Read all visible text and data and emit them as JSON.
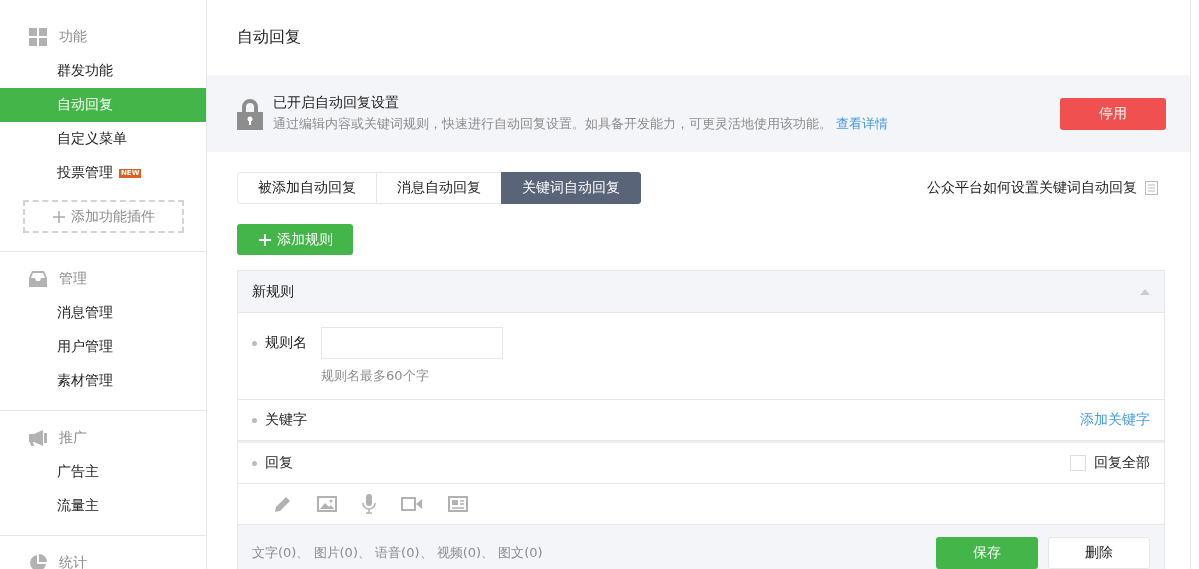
{
  "sidebar": {
    "sections": [
      {
        "title": "功能",
        "kind": "grid",
        "items": [
          {
            "label": "群发功能",
            "selected": false
          },
          {
            "label": "自动回复",
            "selected": true
          },
          {
            "label": "自定义菜单",
            "selected": false
          },
          {
            "label": "投票管理",
            "selected": false,
            "badge": "NEW"
          }
        ],
        "add_button": "添加功能插件"
      },
      {
        "title": "管理",
        "kind": "inbox",
        "items": [
          {
            "label": "消息管理",
            "selected": false
          },
          {
            "label": "用户管理",
            "selected": false
          },
          {
            "label": "素材管理",
            "selected": false
          }
        ]
      },
      {
        "title": "推广",
        "kind": "megaphone",
        "items": [
          {
            "label": "广告主",
            "selected": false
          },
          {
            "label": "流量主",
            "selected": false
          }
        ]
      },
      {
        "title": "统计",
        "kind": "pie"
      }
    ]
  },
  "page_title": "自动回复",
  "notice": {
    "title": "已开启自动回复设置",
    "text": "通过编辑内容或关键词规则，快速进行自动回复设置。如具备开发能力，可更灵活地使用该功能。",
    "link": "查看详情",
    "button": "停用"
  },
  "tabs": [
    {
      "label": "被添加自动回复",
      "selected": false
    },
    {
      "label": "消息自动回复",
      "selected": false
    },
    {
      "label": "关键词自动回复",
      "selected": true
    }
  ],
  "help_link": "公众平台如何设置关键词自动回复",
  "add_rule_button": "添加规则",
  "rule": {
    "title": "新规则",
    "expanded": true,
    "name_label": "规则名",
    "name_hint": "规则名最多60个字",
    "keyword_label": "关键字",
    "add_keyword": "添加关键字",
    "reply_label": "回复",
    "reply_all": {
      "label": "回复全部",
      "checked": false
    },
    "counts": "文字(0)、 图片(0)、 语音(0)、 视频(0)、 图文(0)",
    "save": "保存",
    "delete": "删除"
  }
}
